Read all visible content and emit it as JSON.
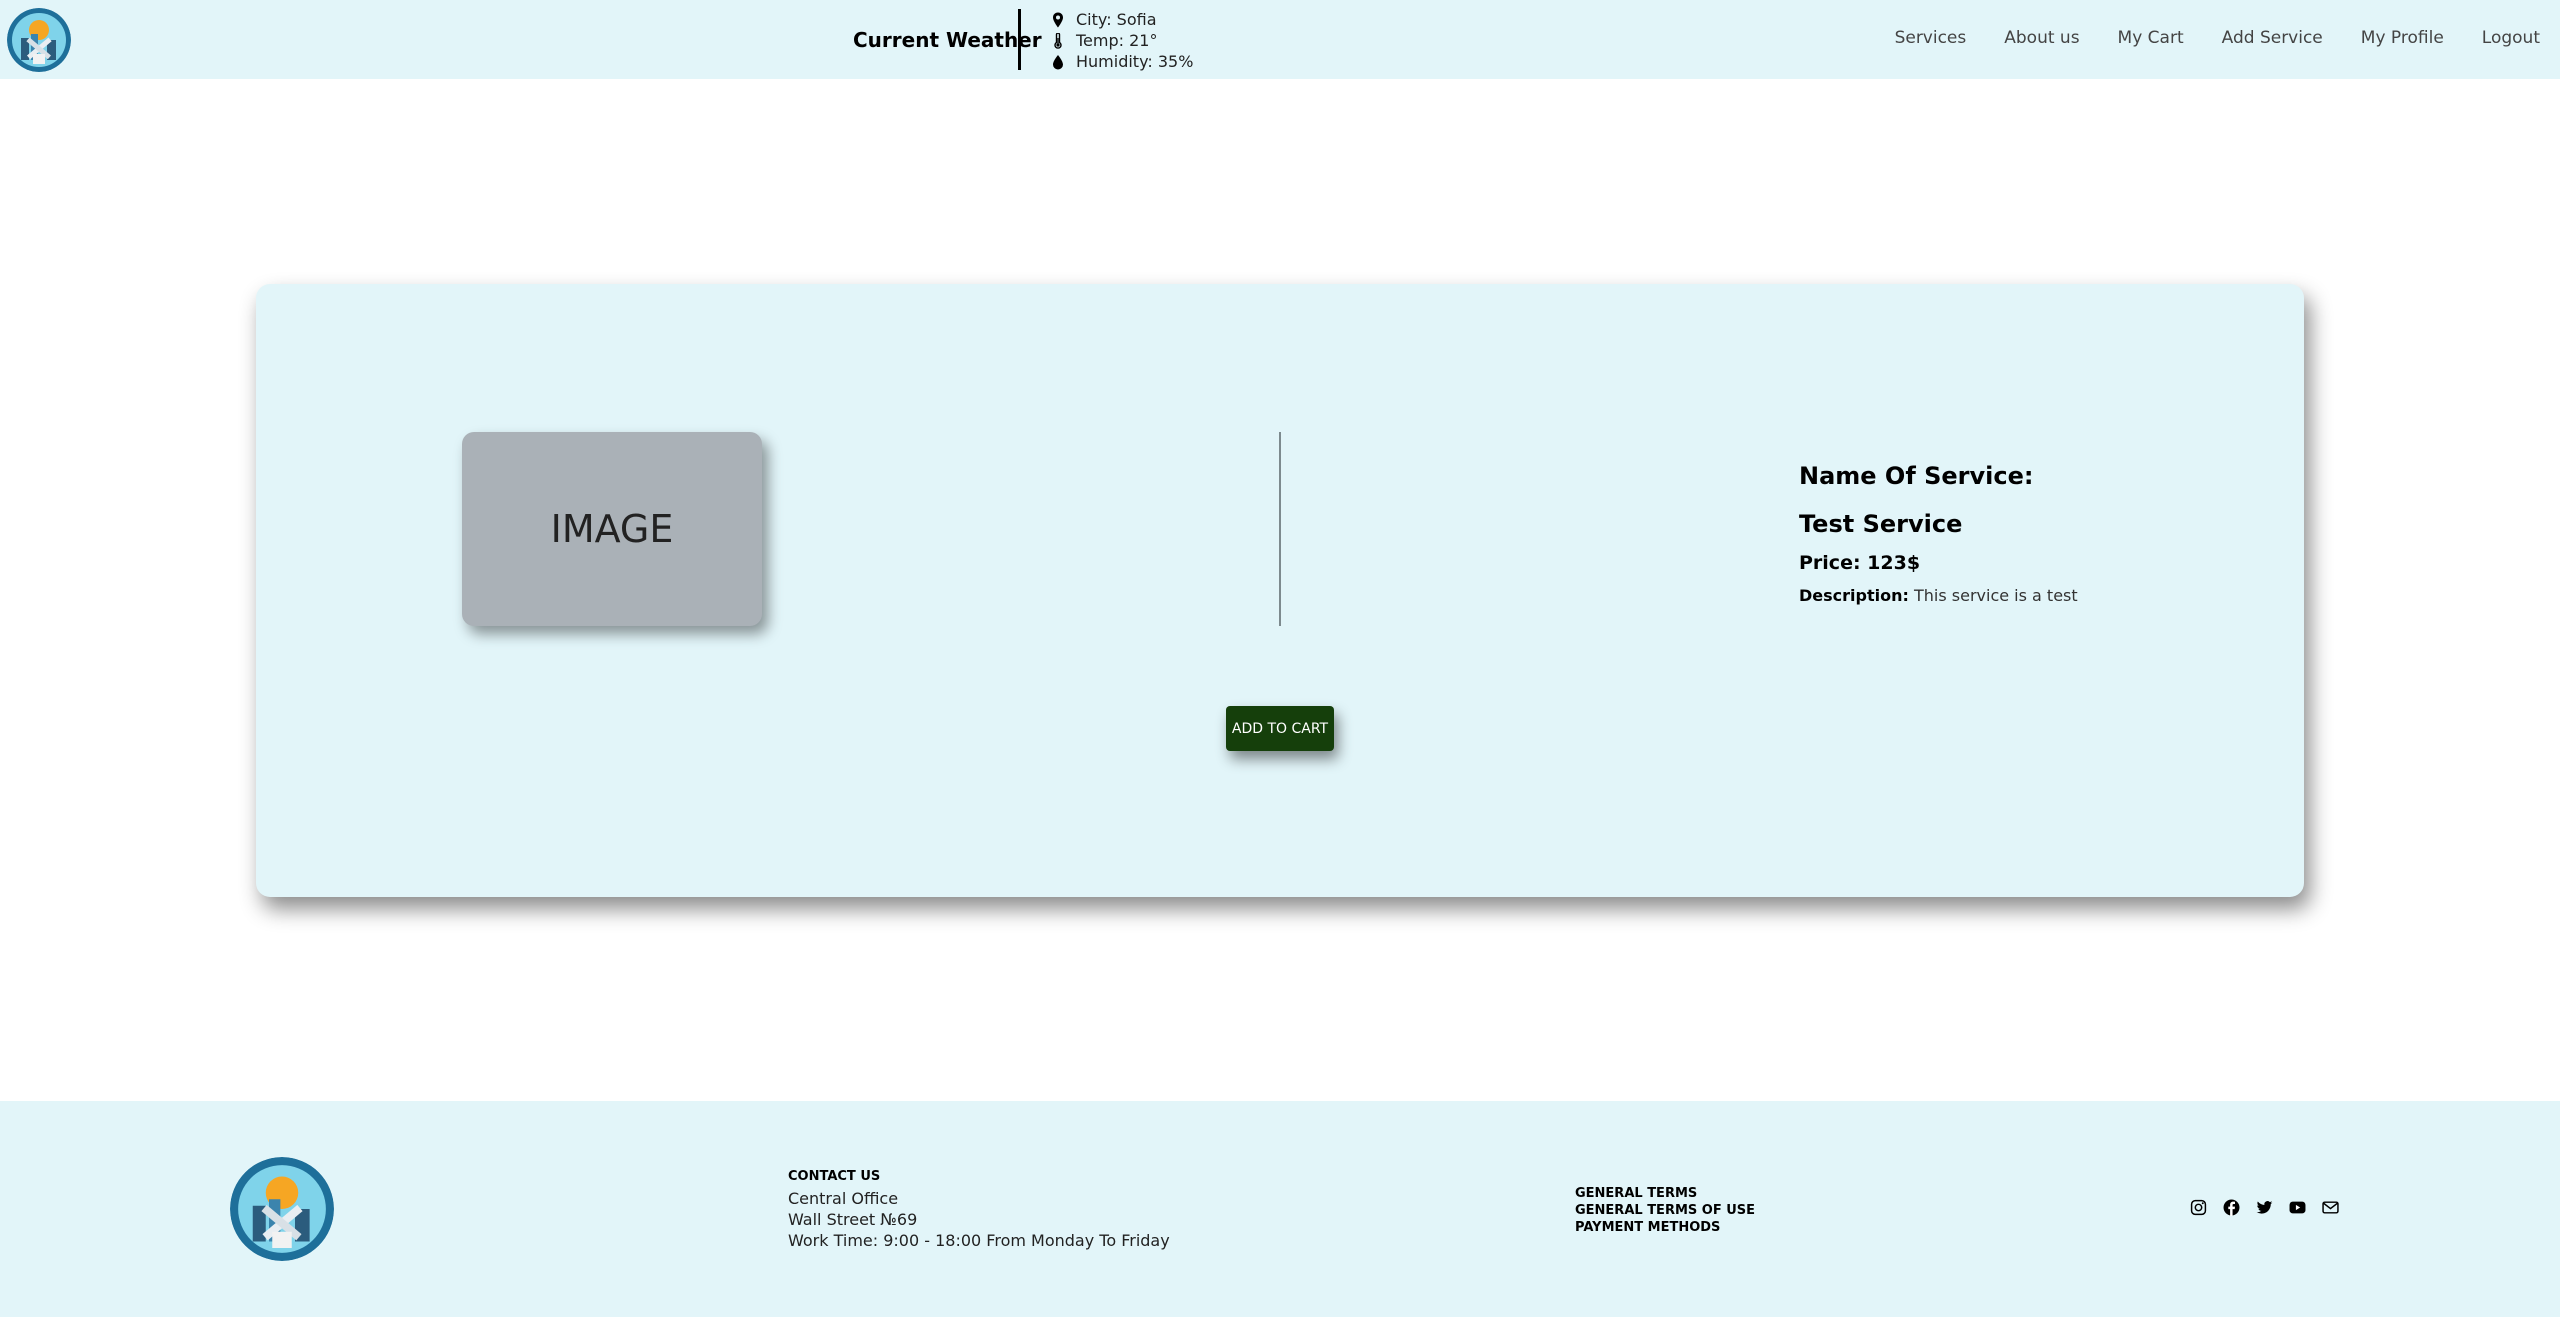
{
  "header": {
    "weather_title": "Current Weather",
    "weather": {
      "city": "City: Sofia",
      "temp": "Temp: 21°",
      "humidity": "Humidity: 35%"
    },
    "nav": [
      "Services",
      "About us",
      "My Cart",
      "Add Service",
      "My Profile",
      "Logout"
    ]
  },
  "card": {
    "image_placeholder": "IMAGE",
    "name": "Name Of Service: Test Service",
    "price": "Price: 123$",
    "description_label": "Description:",
    "description_text": "This service is a test",
    "add_to_cart_label": "ADD TO CART"
  },
  "footer": {
    "contact_title": "CONTACT US",
    "contact_lines": [
      "Central Office",
      "Wall Street №69",
      "Work Time: 9:00 - 18:00 From Monday To Friday"
    ],
    "terms": [
      "GENERAL TERMS",
      "GENERAL TERMS OF USE",
      "PAYMENT METHODS"
    ],
    "social_icons": [
      "instagram-icon",
      "facebook-icon",
      "twitter-icon",
      "youtube-icon",
      "email-icon"
    ]
  },
  "colors": {
    "header_bg": "#e2f5f9",
    "card_bg": "#e2f5f9",
    "button_bg": "#153f0b",
    "image_placeholder_bg": "#aab1b7"
  }
}
